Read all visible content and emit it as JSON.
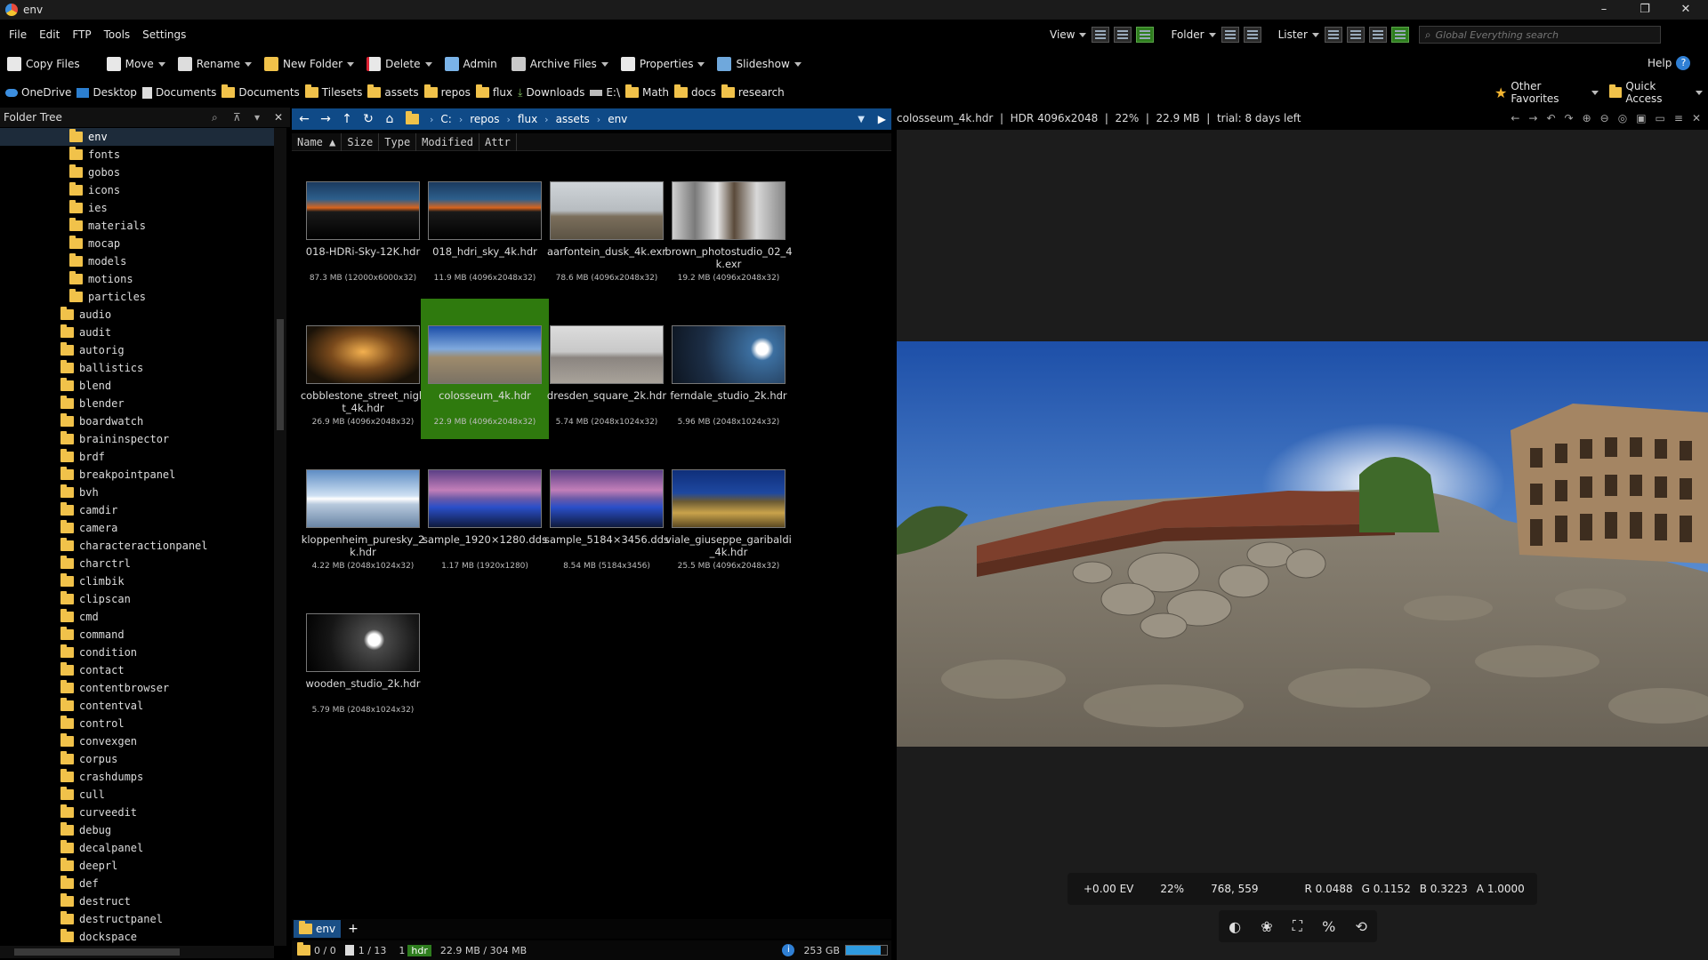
{
  "window": {
    "title": "env",
    "minimize": "–",
    "maximize": "❐",
    "close": "✕"
  },
  "menu": [
    "File",
    "Edit",
    "FTP",
    "Tools",
    "Settings"
  ],
  "view_tools": {
    "view": "View",
    "folder": "Folder",
    "lister": "Lister",
    "search_placeholder": "Global Everything search",
    "help": "Help"
  },
  "toolbar": {
    "copy": "Copy Files",
    "move": "Move",
    "rename": "Rename",
    "new_folder": "New Folder",
    "delete": "Delete",
    "admin": "Admin",
    "archive": "Archive Files",
    "properties": "Properties",
    "slideshow": "Slideshow"
  },
  "favorites": [
    "OneDrive",
    "Desktop",
    "Documents",
    "Documents",
    "Tilesets",
    "assets",
    "repos",
    "flux",
    "Downloads",
    "E:\\",
    "Math",
    "docs",
    "research"
  ],
  "favorites_right": {
    "other": "Other Favorites",
    "quick": "Quick Access"
  },
  "tree": {
    "title": "Folder Tree",
    "selected": "env",
    "sub_items": [
      "fonts",
      "gobos",
      "icons",
      "ies",
      "materials",
      "mocap",
      "models",
      "motions",
      "particles"
    ],
    "items": [
      "audio",
      "audit",
      "autorig",
      "ballistics",
      "blend",
      "blender",
      "boardwatch",
      "braininspector",
      "brdf",
      "breakpointpanel",
      "bvh",
      "camdir",
      "camera",
      "characteractionpanel",
      "charctrl",
      "climbik",
      "clipscan",
      "cmd",
      "command",
      "condition",
      "contact",
      "contentbrowser",
      "contentval",
      "control",
      "convexgen",
      "corpus",
      "crashdumps",
      "cull",
      "curveedit",
      "debug",
      "decalpanel",
      "deeprl",
      "def",
      "destruct",
      "destructpanel",
      "dockspace"
    ]
  },
  "path": [
    "C:",
    "repos",
    "flux",
    "assets",
    "env"
  ],
  "columns": [
    "Name",
    "Size",
    "Type",
    "Modified",
    "Attr"
  ],
  "files": [
    {
      "name": "018-HDRi-Sky-12K.hdr",
      "meta": "87.3 MB (12000x6000x32)",
      "thumb": "sky"
    },
    {
      "name": "018_hdri_sky_4k.hdr",
      "meta": "11.9 MB (4096x2048x32)",
      "thumb": "sky"
    },
    {
      "name": "aarfontein_dusk_4k.exr",
      "meta": "78.6 MB (4096x2048x32)",
      "thumb": "dusk"
    },
    {
      "name": "brown_photostudio_02_4k.exr",
      "meta": "19.2 MB (4096x2048x32)",
      "thumb": "studio"
    },
    {
      "name": "cobblestone_street_night_4k.hdr",
      "meta": "26.9 MB (4096x2048x32)",
      "thumb": "night"
    },
    {
      "name": "colosseum_4k.hdr",
      "meta": "22.9 MB (4096x2048x32)",
      "thumb": "colosseum",
      "selected": true
    },
    {
      "name": "dresden_square_2k.hdr",
      "meta": "5.74 MB (2048x1024x32)",
      "thumb": "square"
    },
    {
      "name": "ferndale_studio_2k.hdr",
      "meta": "5.96 MB (2048x1024x32)",
      "thumb": "ferndale"
    },
    {
      "name": "kloppenheim_puresky_2k.hdr",
      "meta": "4.22 MB (2048x1024x32)",
      "thumb": "puresky"
    },
    {
      "name": "sample_1920×1280.dds",
      "meta": "1.17 MB (1920x1280)",
      "thumb": "purple"
    },
    {
      "name": "sample_5184×3456.dds",
      "meta": "8.54 MB (5184x3456)",
      "thumb": "purple"
    },
    {
      "name": "viale_giuseppe_garibaldi_4k.hdr",
      "meta": "25.5 MB (4096x2048x32)",
      "thumb": "garibaldi"
    },
    {
      "name": "wooden_studio_2k.hdr",
      "meta": "5.79 MB (2048x1024x32)",
      "thumb": "wooden"
    }
  ],
  "lister_tab": {
    "label": "env",
    "add": "+"
  },
  "status": {
    "folders": "0 / 0",
    "files": "1 / 13",
    "sel_count": "1",
    "sel_type": "hdr",
    "size": "22.9 MB / 304 MB",
    "disk_free": "253 GB",
    "disk_used_fraction": 0.85
  },
  "viewer": {
    "info": "colosseum_4k.hdr  |  HDR 4096x2048  |  22%  |  22.9 MB  |  trial: 8 days left",
    "ev": "+0.00 EV",
    "zoom": "22%",
    "coords": "768, 559",
    "r": "R 0.0488",
    "g": "G 0.1152",
    "b": "B 0.3223",
    "a": "A 1.0000"
  }
}
